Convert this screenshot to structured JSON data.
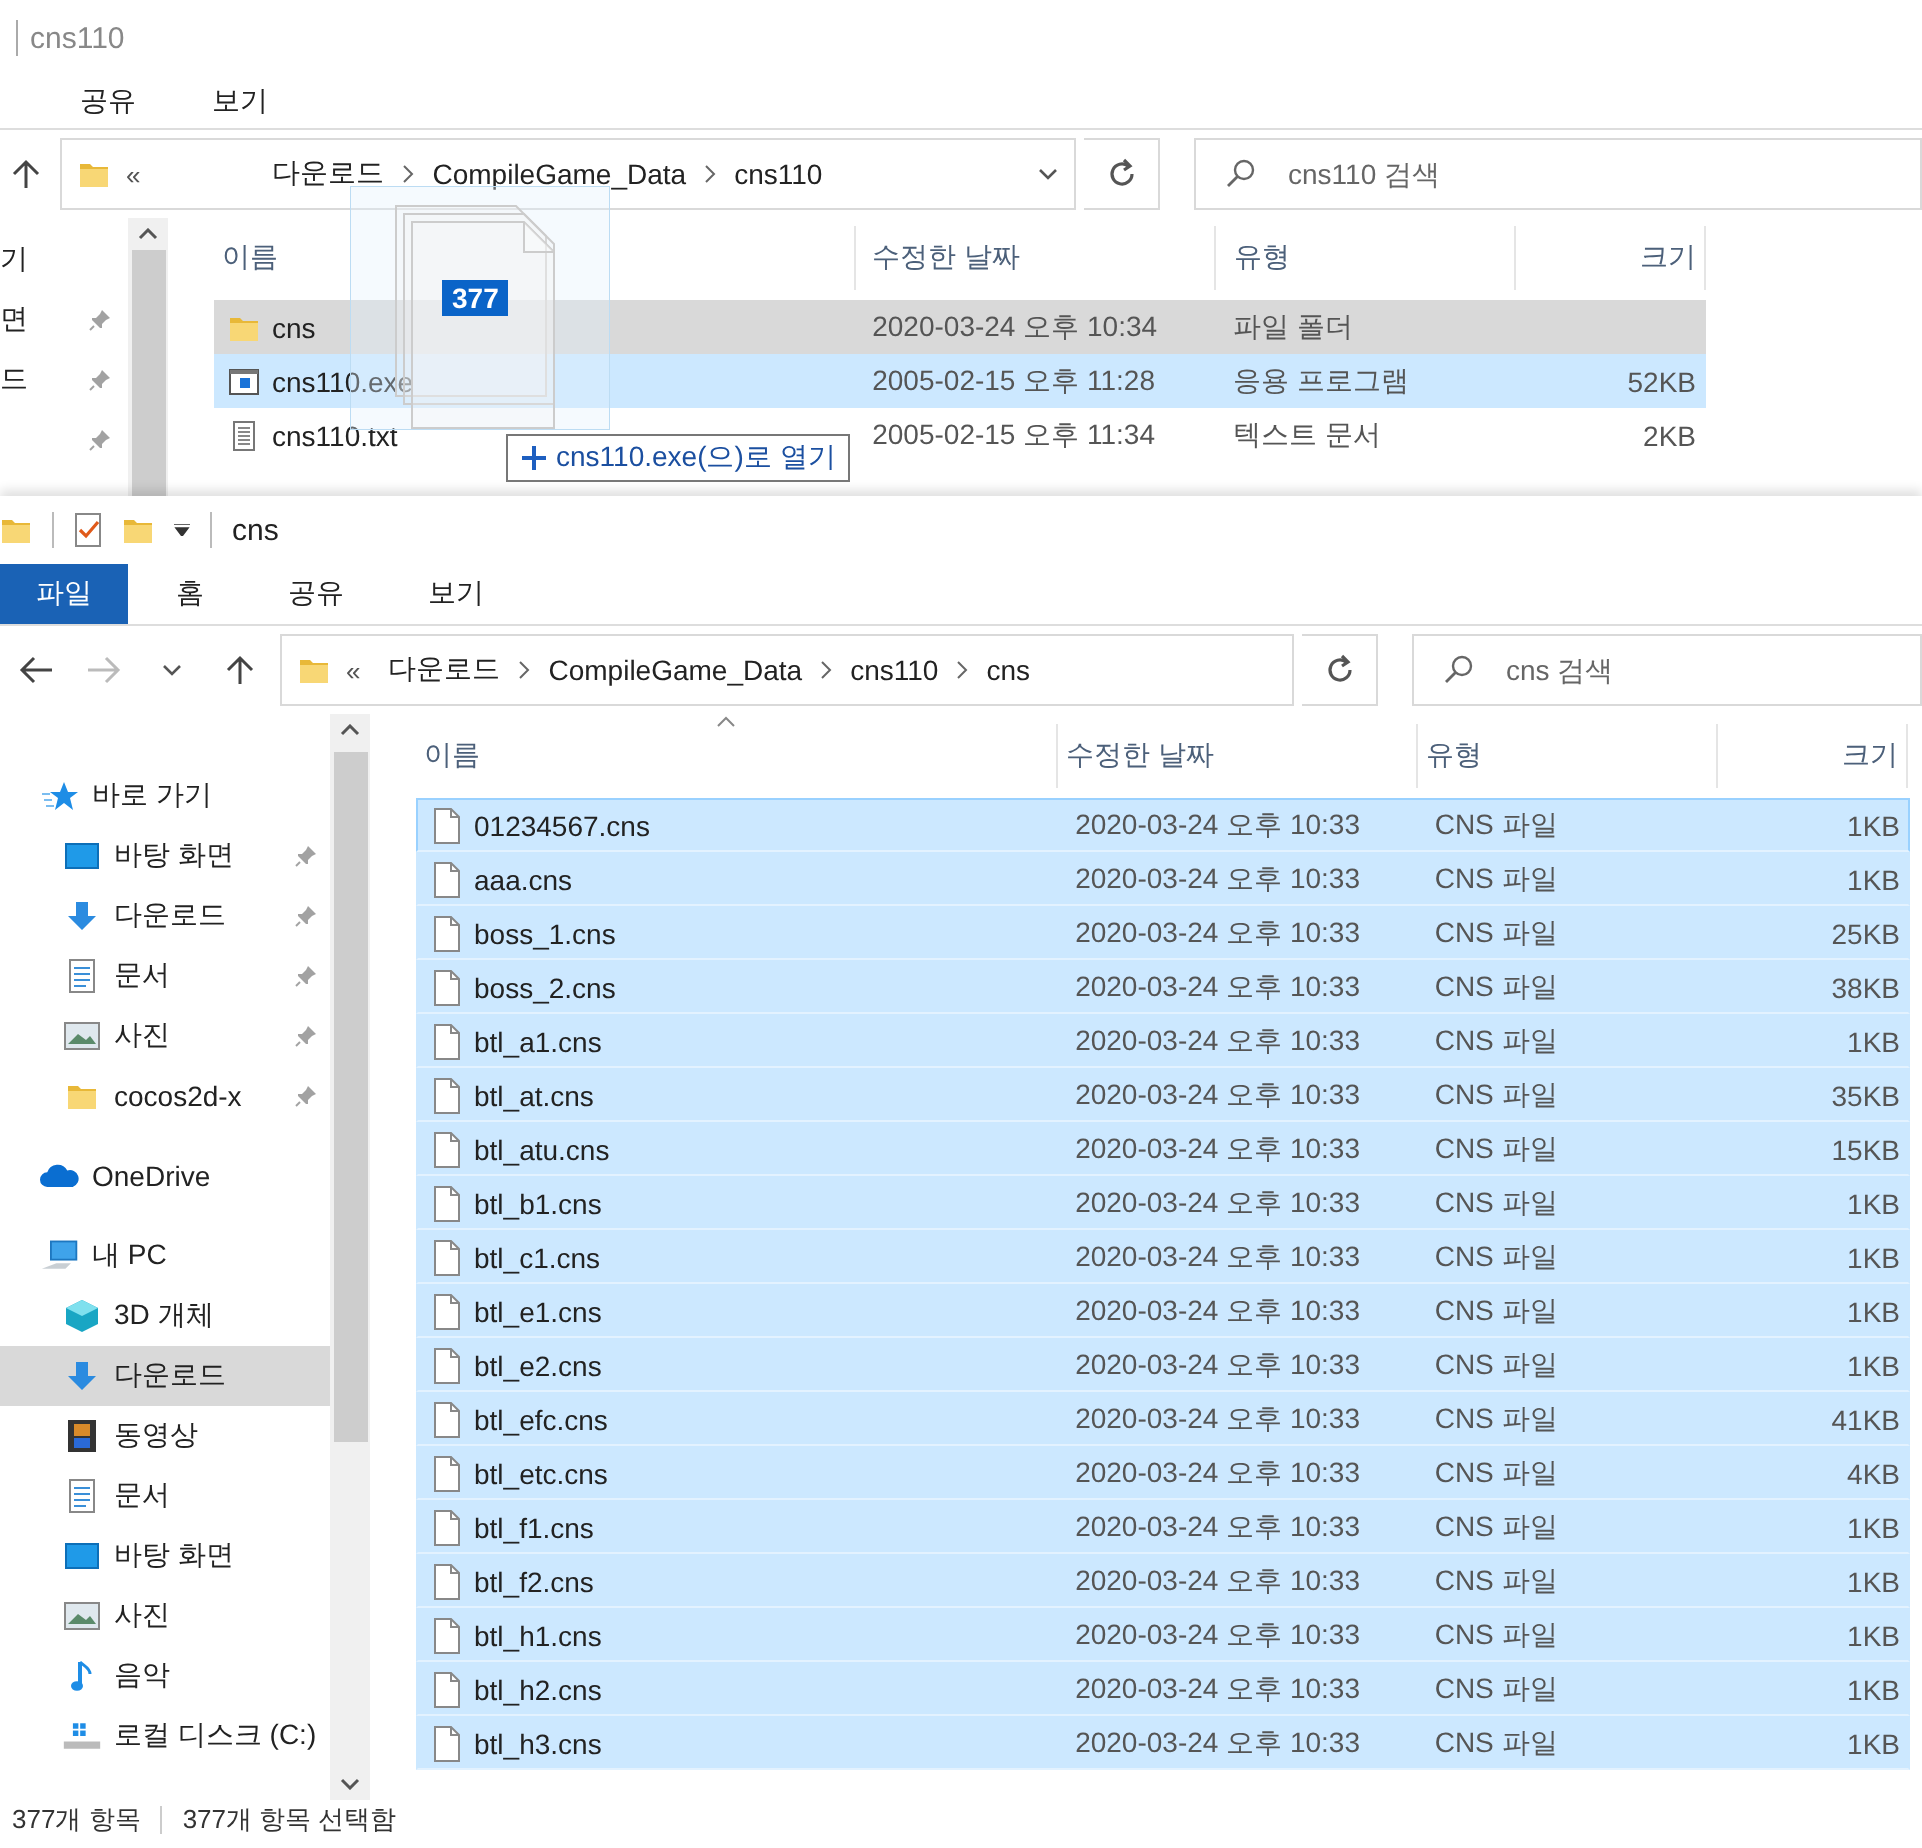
{
  "back_window": {
    "title": "cns110",
    "ribbon_tabs": [
      {
        "label": "공유",
        "selected": false
      },
      {
        "label": "보기",
        "selected": false
      }
    ],
    "address": {
      "overflow": "«",
      "path": [
        "다운로드",
        "CompileGame_Data",
        "cns110"
      ]
    },
    "search": {
      "placeholder": "cns110 검색"
    },
    "nav_items": [
      {
        "label": "기",
        "pinned": false
      },
      {
        "label": "면",
        "pinned": true
      },
      {
        "label": "드",
        "pinned": true
      },
      {
        "pinned": true
      }
    ],
    "columns": [
      "이름",
      "수정한 날짜",
      "유형",
      "크기"
    ],
    "files": [
      {
        "kind": "folder",
        "name": "cns",
        "modified": "2020-03-24 오후 10:34",
        "type": "파일 폴더",
        "hovered": true,
        "selected": false
      },
      {
        "kind": "program",
        "name": "cns110.exe",
        "modified": "2005-02-15 오후 11:28",
        "type": "응용 프로그램",
        "size": "52KB",
        "hovered": false,
        "selected": true
      },
      {
        "kind": "text",
        "name": "cns110.txt",
        "modified": "2005-02-15 오후 11:34",
        "type": "텍스트 문서",
        "size": "2KB",
        "hovered": false,
        "selected": false
      }
    ]
  },
  "drag": {
    "count": "377",
    "tooltip": "cns110.exe(으)로 열기"
  },
  "front_window": {
    "title": "cns",
    "ribbon_tabs": [
      {
        "label": "파일",
        "selected": true
      },
      {
        "label": "홈",
        "selected": false
      },
      {
        "label": "공유",
        "selected": false
      },
      {
        "label": "보기",
        "selected": false
      }
    ],
    "address": {
      "overflow": "«",
      "path": [
        "다운로드",
        "CompileGame_Data",
        "cns110",
        "cns"
      ]
    },
    "search": {
      "placeholder": "cns 검색"
    },
    "nav_tree": [
      {
        "kind": "star",
        "label": "바로 가기",
        "selected": false,
        "children": [
          {
            "kind": "desktop",
            "label": "바탕 화면",
            "pinned": true,
            "selected": false
          },
          {
            "kind": "download",
            "label": "다운로드",
            "pinned": true,
            "selected": false
          },
          {
            "kind": "document",
            "label": "문서",
            "pinned": true,
            "selected": false
          },
          {
            "kind": "pictures",
            "label": "사진",
            "pinned": true,
            "selected": false
          },
          {
            "kind": "folder",
            "label": "cocos2d-x",
            "pinned": true,
            "selected": false
          }
        ]
      },
      {
        "kind": "cloud",
        "label": "OneDrive",
        "selected": false
      },
      {
        "kind": "pc",
        "label": "내 PC",
        "selected": false,
        "children": [
          {
            "kind": "cube",
            "label": "3D 개체",
            "selected": false
          },
          {
            "kind": "download",
            "label": "다운로드",
            "selected": true
          },
          {
            "kind": "video",
            "label": "동영상",
            "selected": false
          },
          {
            "kind": "document",
            "label": "문서",
            "selected": false
          },
          {
            "kind": "desktop",
            "label": "바탕 화면",
            "selected": false
          },
          {
            "kind": "pictures",
            "label": "사진",
            "selected": false
          },
          {
            "kind": "music",
            "label": "음악",
            "selected": false
          },
          {
            "kind": "drive",
            "label": "로컬 디스크 (C:)",
            "selected": false
          }
        ]
      }
    ],
    "columns": [
      "이름",
      "수정한 날짜",
      "유형",
      "크기"
    ],
    "files": [
      {
        "name": "01234567.cns",
        "modified": "2020-03-24 오후 10:33",
        "type": "CNS 파일",
        "size": "1KB",
        "selected": true,
        "focused": true
      },
      {
        "name": "aaa.cns",
        "modified": "2020-03-24 오후 10:33",
        "type": "CNS 파일",
        "size": "1KB",
        "selected": true,
        "focused": false
      },
      {
        "name": "boss_1.cns",
        "modified": "2020-03-24 오후 10:33",
        "type": "CNS 파일",
        "size": "25KB",
        "selected": true,
        "focused": false
      },
      {
        "name": "boss_2.cns",
        "modified": "2020-03-24 오후 10:33",
        "type": "CNS 파일",
        "size": "38KB",
        "selected": true,
        "focused": false
      },
      {
        "name": "btl_a1.cns",
        "modified": "2020-03-24 오후 10:33",
        "type": "CNS 파일",
        "size": "1KB",
        "selected": true,
        "focused": false
      },
      {
        "name": "btl_at.cns",
        "modified": "2020-03-24 오후 10:33",
        "type": "CNS 파일",
        "size": "35KB",
        "selected": true,
        "focused": false
      },
      {
        "name": "btl_atu.cns",
        "modified": "2020-03-24 오후 10:33",
        "type": "CNS 파일",
        "size": "15KB",
        "selected": true,
        "focused": false
      },
      {
        "name": "btl_b1.cns",
        "modified": "2020-03-24 오후 10:33",
        "type": "CNS 파일",
        "size": "1KB",
        "selected": true,
        "focused": false
      },
      {
        "name": "btl_c1.cns",
        "modified": "2020-03-24 오후 10:33",
        "type": "CNS 파일",
        "size": "1KB",
        "selected": true,
        "focused": false
      },
      {
        "name": "btl_e1.cns",
        "modified": "2020-03-24 오후 10:33",
        "type": "CNS 파일",
        "size": "1KB",
        "selected": true,
        "focused": false
      },
      {
        "name": "btl_e2.cns",
        "modified": "2020-03-24 오후 10:33",
        "type": "CNS 파일",
        "size": "1KB",
        "selected": true,
        "focused": false
      },
      {
        "name": "btl_efc.cns",
        "modified": "2020-03-24 오후 10:33",
        "type": "CNS 파일",
        "size": "41KB",
        "selected": true,
        "focused": false
      },
      {
        "name": "btl_etc.cns",
        "modified": "2020-03-24 오후 10:33",
        "type": "CNS 파일",
        "size": "4KB",
        "selected": true,
        "focused": false
      },
      {
        "name": "btl_f1.cns",
        "modified": "2020-03-24 오후 10:33",
        "type": "CNS 파일",
        "size": "1KB",
        "selected": true,
        "focused": false
      },
      {
        "name": "btl_f2.cns",
        "modified": "2020-03-24 오후 10:33",
        "type": "CNS 파일",
        "size": "1KB",
        "selected": true,
        "focused": false
      },
      {
        "name": "btl_h1.cns",
        "modified": "2020-03-24 오후 10:33",
        "type": "CNS 파일",
        "size": "1KB",
        "selected": true,
        "focused": false
      },
      {
        "name": "btl_h2.cns",
        "modified": "2020-03-24 오후 10:33",
        "type": "CNS 파일",
        "size": "1KB",
        "selected": true,
        "focused": false
      },
      {
        "name": "btl_h3.cns",
        "modified": "2020-03-24 오후 10:33",
        "type": "CNS 파일",
        "size": "1KB",
        "selected": true,
        "focused": false
      }
    ],
    "status_bar": [
      "377개 항목",
      "377개 항목 선택함"
    ]
  }
}
